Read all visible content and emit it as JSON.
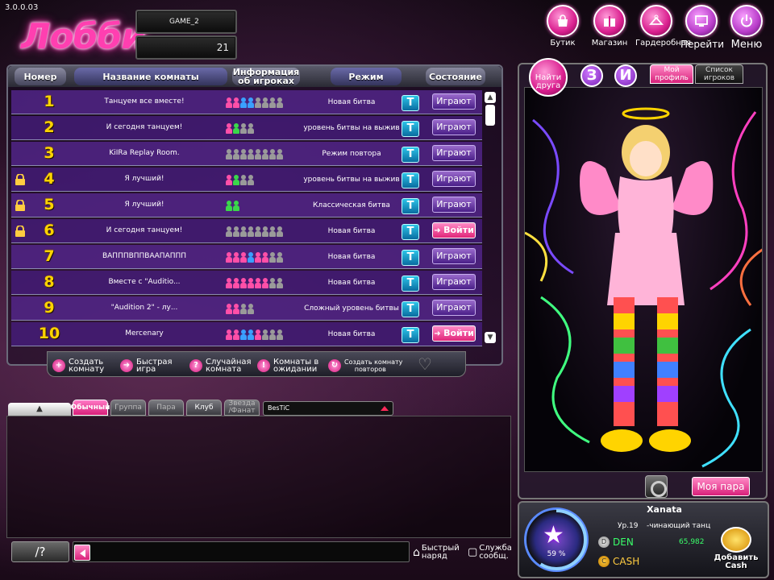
{
  "version": "3.0.0.03",
  "title": "Лобби",
  "server": {
    "name": "GAME_2",
    "channel": "21"
  },
  "top_nav": [
    {
      "label": "Бутик",
      "icon": "handbag-icon"
    },
    {
      "label": "Магазин",
      "icon": "gift-box-icon"
    },
    {
      "label": "Гардеробная",
      "icon": "hanger-icon"
    },
    {
      "label": "Перейти",
      "icon": "monitor-icon"
    },
    {
      "label": "Меню",
      "icon": "power-icon"
    }
  ],
  "room_table": {
    "headers": {
      "number": "Номер",
      "name": "Название комнаты",
      "info": "Информация об игроках",
      "mode": "Режим",
      "state": "Состояние"
    },
    "rows": [
      {
        "num": "1",
        "name": "Танцуем все вместе!",
        "players": [
          "#ff4fa8",
          "#ff4fa8",
          "#3aa0ff",
          "#3aa0ff",
          "#9a9a9a",
          "#9a9a9a",
          "#9a9a9a",
          "#9a9a9a"
        ],
        "mode": "Новая битва",
        "t": "T",
        "status": "Играют",
        "locked": false,
        "joinable": false
      },
      {
        "num": "2",
        "name": "И сегодня танцуем!",
        "players": [
          "#ff4fa8",
          "#3ad84a",
          "#9a9a9a",
          "#9a9a9a"
        ],
        "mode": "уровень битвы на выжив",
        "t": "T",
        "status": "Играют",
        "locked": false,
        "joinable": false
      },
      {
        "num": "3",
        "name": "KiIRa Replay Room.",
        "players": [
          "#9a9a9a",
          "#9a9a9a",
          "#9a9a9a",
          "#9a9a9a",
          "#9a9a9a",
          "#9a9a9a",
          "#9a9a9a",
          "#9a9a9a"
        ],
        "mode": "Режим повтора",
        "t": "T",
        "status": "Играют",
        "locked": false,
        "joinable": false
      },
      {
        "num": "4",
        "name": "Я лучший!",
        "players": [
          "#ff4fa8",
          "#3ad84a",
          "#9a9a9a",
          "#9a9a9a"
        ],
        "mode": "уровень битвы на выжив",
        "t": "T",
        "status": "Играют",
        "locked": true,
        "joinable": false
      },
      {
        "num": "5",
        "name": "Я лучший!",
        "players": [
          "#3ad84a",
          "#3ad84a"
        ],
        "mode": "Классическая битва",
        "t": "T",
        "status": "Играют",
        "locked": true,
        "joinable": false
      },
      {
        "num": "6",
        "name": "И сегодня танцуем!",
        "players": [
          "#9a9a9a",
          "#9a9a9a",
          "#9a9a9a",
          "#9a9a9a",
          "#9a9a9a",
          "#9a9a9a",
          "#9a9a9a",
          "#9a9a9a"
        ],
        "mode": "Новая битва",
        "t": "T",
        "status": "Войти",
        "locked": true,
        "joinable": true
      },
      {
        "num": "7",
        "name": "ВАПППВППВААПАППП",
        "players": [
          "#ff4fa8",
          "#ff4fa8",
          "#ff4fa8",
          "#3aa0ff",
          "#ff4fa8",
          "#ff4fa8",
          "#9a9a9a",
          "#9a9a9a"
        ],
        "mode": "Новая битва",
        "t": "T",
        "status": "Играют",
        "locked": false,
        "joinable": false
      },
      {
        "num": "8",
        "name": "Вместе с \"Auditio...",
        "players": [
          "#ff4fa8",
          "#ff4fa8",
          "#ff4fa8",
          "#ff4fa8",
          "#ff4fa8",
          "#ff4fa8",
          "#9a9a9a",
          "#9a9a9a"
        ],
        "mode": "Новая битва",
        "t": "T",
        "status": "Играют",
        "locked": false,
        "joinable": false
      },
      {
        "num": "9",
        "name": "\"Audition 2\" - лу...",
        "players": [
          "#ff4fa8",
          "#ff4fa8",
          "#9a9a9a",
          "#9a9a9a"
        ],
        "mode": "Сложный уровень битвы",
        "t": "T",
        "status": "Играют",
        "locked": false,
        "joinable": false
      },
      {
        "num": "10",
        "name": "Mercenary",
        "players": [
          "#ff4fa8",
          "#ff4fa8",
          "#3aa0ff",
          "#3aa0ff",
          "#ff4fa8",
          "#9a9a9a",
          "#9a9a9a",
          "#9a9a9a"
        ],
        "mode": "Новая битва",
        "t": "T",
        "status": "Войти",
        "locked": false,
        "joinable": true
      }
    ]
  },
  "actions": {
    "create_l1": "Создать",
    "create_l2": "комнату",
    "quick_l1": "Быстрая",
    "quick_l2": "игра",
    "random_l1": "Случайная",
    "random_l2": "комната",
    "waiting_l1": "Комнаты в",
    "waiting_l2": "ожидании",
    "replay_l1": "Создать комнату",
    "replay_l2": "повторов"
  },
  "chat": {
    "tabs": [
      "Обычный",
      "Группа",
      "Пара",
      "Клуб"
    ],
    "star_tab_l1": "Звезда",
    "star_tab_l2": "/Фанат",
    "channel_name": "BesTiC",
    "command_label": "/?",
    "quick_outfit_l1": "Быстрый",
    "quick_outfit_l2": "наряд",
    "service_l1": "Служба",
    "service_l2": "сообщ."
  },
  "profile": {
    "find_friend_l1": "Найти",
    "find_friend_l2": "друга",
    "btn3": "З",
    "btn_i": "И",
    "tab_profile_l1": "Мой",
    "tab_profile_l2": "профиль",
    "tab_list_l1": "Список",
    "tab_list_l2": "игроков",
    "my_pair": "Моя пара",
    "username": "Xanata",
    "level": "Ур.19",
    "rank": "-чинающий танц",
    "den_label": "DEN",
    "den_value": "65,982",
    "cash_label": "CASH",
    "exp_percent": "59 %",
    "exp_fraction": 0.59,
    "add_cash_l1": "Добавить",
    "add_cash_l2": "Cash"
  },
  "colors": {
    "accent": "#ff3fb0",
    "table_row": "#5a2896",
    "gold": "#ffd400"
  }
}
